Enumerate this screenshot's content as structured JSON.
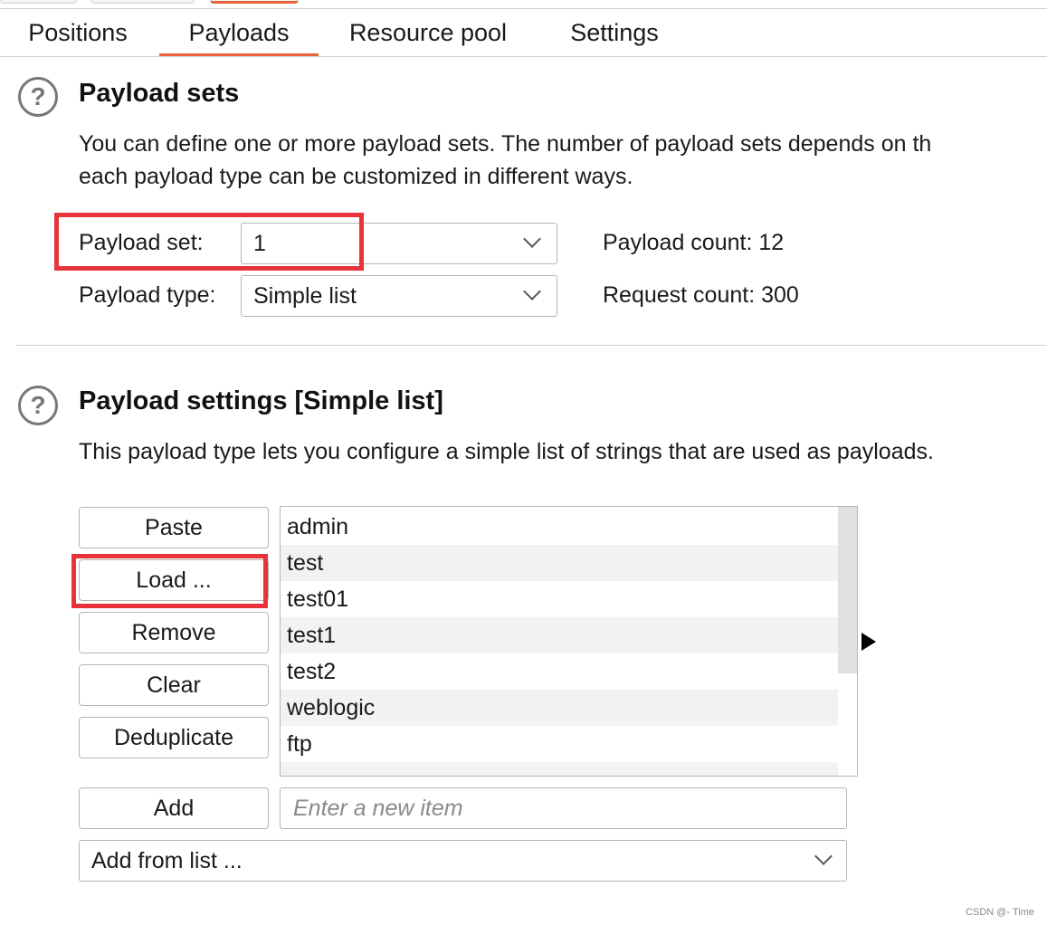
{
  "tabs": [
    {
      "label": "Positions",
      "active": false
    },
    {
      "label": "Payloads",
      "active": true
    },
    {
      "label": "Resource pool",
      "active": false
    },
    {
      "label": "Settings",
      "active": false
    }
  ],
  "payload_sets": {
    "title": "Payload sets",
    "description_line1": "You can define one or more payload sets. The number of payload sets depends on th",
    "description_line2": "each payload type can be customized in different ways.",
    "payload_set_label": "Payload set:",
    "payload_set_value": "1",
    "payload_type_label": "Payload type:",
    "payload_type_value": "Simple list",
    "payload_count_label": "Payload count:",
    "payload_count_value": "12",
    "request_count_label": "Request count:",
    "request_count_value": "300"
  },
  "payload_settings": {
    "title": "Payload settings [Simple list]",
    "description": "This payload type lets you configure a simple list of strings that are used as payloads.",
    "buttons": {
      "paste": "Paste",
      "load": "Load ...",
      "remove": "Remove",
      "clear": "Clear",
      "deduplicate": "Deduplicate",
      "add": "Add"
    },
    "items": [
      "admin",
      "test",
      "test01",
      "test1",
      "test2",
      "weblogic",
      "ftp"
    ],
    "new_item_placeholder": "Enter a new item",
    "add_from_list": "Add from list ..."
  },
  "watermark": "CSDN @- Time",
  "colors": {
    "accent": "#e8643a",
    "highlight": "#e8333a"
  }
}
